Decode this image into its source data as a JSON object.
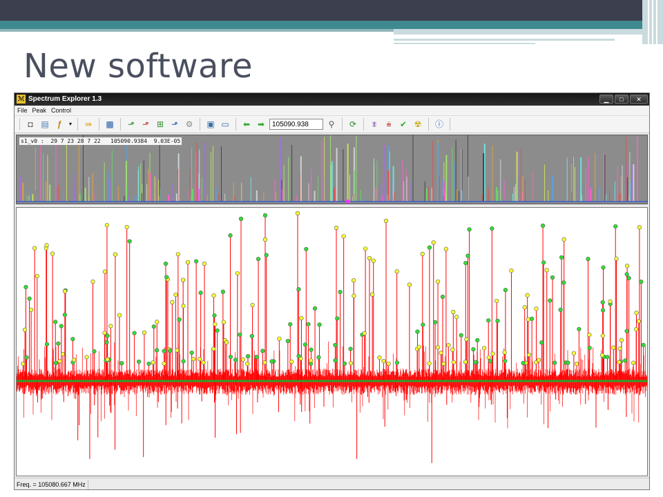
{
  "slide": {
    "title": "New software"
  },
  "window": {
    "title": "Spectrum Explorer 1.3",
    "controls": [
      "minimize-icon",
      "maximize-icon",
      "close-icon"
    ]
  },
  "menu": {
    "items": [
      "File",
      "Peak",
      "Control"
    ]
  },
  "toolbar": {
    "frequency_value": "105090.938",
    "icons": [
      "camera-icon",
      "folder-icon",
      "function-icon",
      "dropdown-arrow-icon",
      "load-icon",
      "chart-icon",
      "peak-add-icon",
      "peak-remove-icon",
      "peak-select-icon",
      "peak-clear-icon",
      "settings-icon",
      "window-icon",
      "window-alt-icon",
      "back-arrow-icon",
      "forward-arrow-icon",
      "search-icon",
      "refresh-icon",
      "assign-icon",
      "assign-alt-icon",
      "check-icon",
      "radiation-icon",
      "info-icon"
    ]
  },
  "overview": {
    "readout": "s1_v0 :  29 7 23 28 7 22   105090.9384  9.03E-05",
    "background_color": "#8c8c8c"
  },
  "main_plot": {
    "baseline_color": "#2aa52a",
    "spectrum_color": "#ff0000",
    "marker_colors": {
      "assigned": "#33dd33",
      "unassigned": "#ffff33"
    }
  },
  "status": {
    "frequency": "Freq. = 105080.667 MHz"
  },
  "colors": {
    "slide_top": "#3b3f4e",
    "slide_band": "#3f8a8e",
    "title_text": "#4a4f5e"
  }
}
